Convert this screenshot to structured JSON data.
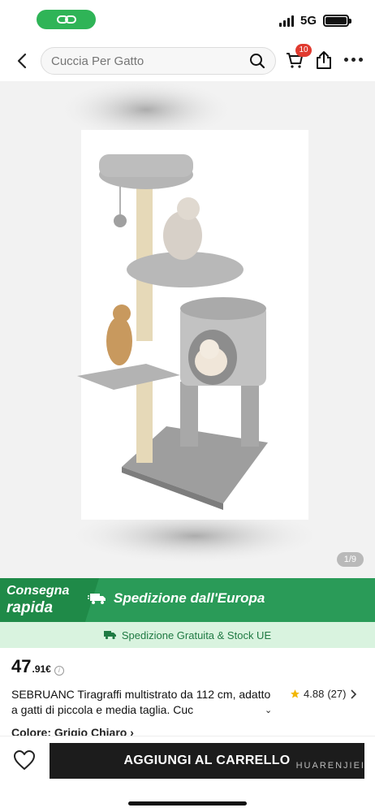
{
  "status_bar": {
    "network": "5G",
    "pill_color": "#2fb457",
    "link_icon": "link-icon"
  },
  "nav": {
    "back_icon": "chevron-left-icon",
    "search_placeholder": "Cuccia Per Gatto",
    "cart_badge": "10",
    "share_icon": "share-icon",
    "more_icon": "more-icon"
  },
  "gallery": {
    "counter": "1/9"
  },
  "delivery": {
    "fast_line1": "Consegna",
    "fast_line2": "rapida",
    "shipping_from": "Spedizione dall'Europa",
    "free_shipping": "Spedizione Gratuita & Stock UE",
    "accent": "#2a9b58"
  },
  "product": {
    "price_int": "47",
    "price_dec": ".91€",
    "title": "SEBRUANC Tiragraffi multistrato da 112 cm, adatto a gatti di piccola e media taglia. Cuc",
    "rating": "4.88",
    "reviews": "(27)",
    "color_label": "Colore: Grigio Chiaro"
  },
  "actions": {
    "add_to_cart": "AGGIUNGI AL CARRELLO",
    "watermark": "HUARENJIEI"
  }
}
